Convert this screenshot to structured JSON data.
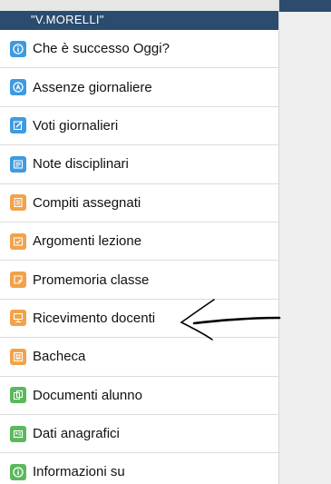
{
  "header": {
    "title": "\"V.MORELLI\""
  },
  "menu": {
    "items": [
      {
        "label": "Che è successo Oggi?",
        "icon": "info-icon",
        "color": "#3f9ae0"
      },
      {
        "label": "Assenze giornaliere",
        "icon": "absence-icon",
        "color": "#3f9ae0"
      },
      {
        "label": "Voti giornalieri",
        "icon": "grades-icon",
        "color": "#3f9ae0"
      },
      {
        "label": "Note disciplinari",
        "icon": "notes-icon",
        "color": "#3f9ae0"
      },
      {
        "label": "Compiti assegnati",
        "icon": "homework-icon",
        "color": "#f2a24a"
      },
      {
        "label": "Argomenti lezione",
        "icon": "lesson-topics-icon",
        "color": "#f2a24a"
      },
      {
        "label": "Promemoria classe",
        "icon": "reminder-icon",
        "color": "#f2a24a"
      },
      {
        "label": "Ricevimento docenti",
        "icon": "teacher-meeting-icon",
        "color": "#f2a24a"
      },
      {
        "label": "Bacheca",
        "icon": "bulletin-board-icon",
        "color": "#f2a24a"
      },
      {
        "label": "Documenti alunno",
        "icon": "student-documents-icon",
        "color": "#5cb85c"
      },
      {
        "label": "Dati anagrafici",
        "icon": "personal-data-icon",
        "color": "#5cb85c"
      },
      {
        "label": "Informazioni su",
        "icon": "info-about-icon",
        "color": "#5cb85c"
      }
    ]
  },
  "colors": {
    "header_bg": "#2b4c6f",
    "blue": "#3f9ae0",
    "orange": "#f2a24a",
    "green": "#5cb85c"
  }
}
